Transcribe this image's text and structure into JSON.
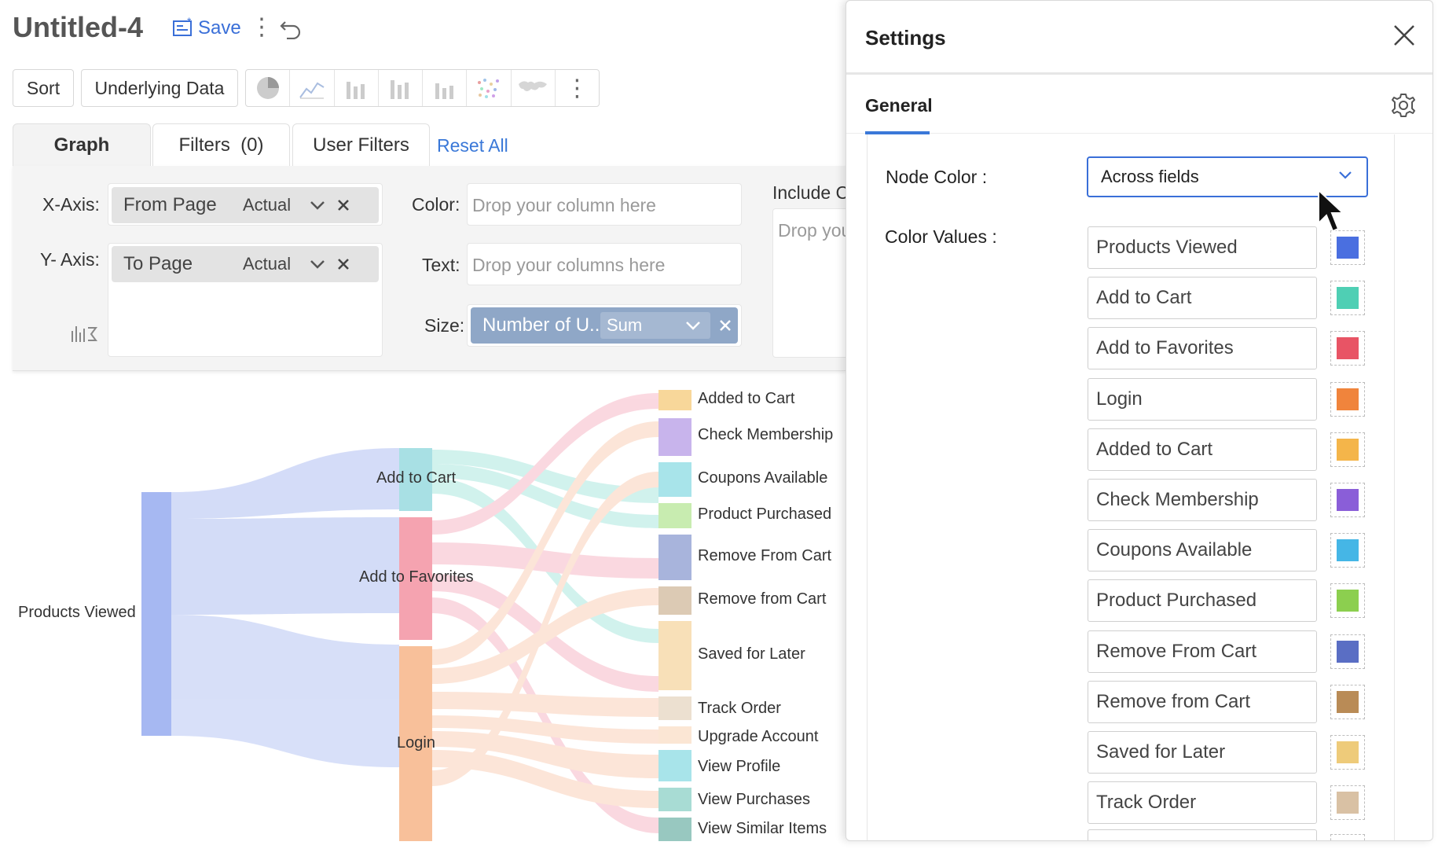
{
  "header": {
    "title": "Untitled-4",
    "save_label": "Save"
  },
  "toolbar": {
    "sort_label": "Sort",
    "underlying_label": "Underlying Data",
    "chart_type_icons": [
      "pie-chart-icon",
      "line-chart-icon",
      "bar-chart-icon",
      "stacked-bar-icon",
      "column-chart-icon",
      "scatter-chart-icon",
      "map-chart-icon",
      "more-icon"
    ]
  },
  "tabs": {
    "graph": "Graph",
    "filters": "Filters  (0)",
    "user_filters": "User Filters",
    "reset_all": "Reset All"
  },
  "config": {
    "x_axis_label": "X-Axis:",
    "x_axis_field": "From Page",
    "x_axis_agg": "Actual",
    "y_axis_label": "Y- Axis:",
    "y_axis_field": "To Page",
    "y_axis_agg": "Actual",
    "color_label": "Color:",
    "color_placeholder": "Drop your column here",
    "text_label": "Text:",
    "text_placeholder": "Drop your columns here",
    "size_label": "Size:",
    "size_field": "Number of U...",
    "size_agg": "Sum",
    "include_label": "Include C",
    "include_placeholder": "Drop you"
  },
  "chart_data": {
    "type": "sankey",
    "source_nodes": [
      "Products Viewed"
    ],
    "middle_nodes": [
      "Add to Cart",
      "Add to Favorites",
      "Login"
    ],
    "target_nodes": [
      "Added to Cart",
      "Check Membership",
      "Coupons Available",
      "Product Purchased",
      "Remove From Cart",
      "Remove from Cart",
      "Saved for Later",
      "Track Order",
      "Upgrade Account",
      "View Profile",
      "View Purchases",
      "View Similar Items"
    ]
  },
  "settings": {
    "title": "Settings",
    "general_tab": "General",
    "node_color_label": "Node Color :",
    "node_color_value": "Across fields",
    "color_values_label": "Color Values :",
    "color_values": [
      {
        "label": "Products Viewed",
        "color": "#4a6fe0"
      },
      {
        "label": "Add to Cart",
        "color": "#4fcfb4"
      },
      {
        "label": "Add to Favorites",
        "color": "#e85465"
      },
      {
        "label": "Login",
        "color": "#f0843c"
      },
      {
        "label": "Added to Cart",
        "color": "#f4b54a"
      },
      {
        "label": "Check Membership",
        "color": "#8a5ed8"
      },
      {
        "label": "Coupons Available",
        "color": "#45b6e6"
      },
      {
        "label": "Product Purchased",
        "color": "#8ccf4f"
      },
      {
        "label": "Remove From Cart",
        "color": "#5a6ec4"
      },
      {
        "label": "Remove from Cart",
        "color": "#b98b56"
      },
      {
        "label": "Saved for Later",
        "color": "#eecb7a"
      },
      {
        "label": "Track Order",
        "color": "#d9c1a4"
      }
    ]
  }
}
